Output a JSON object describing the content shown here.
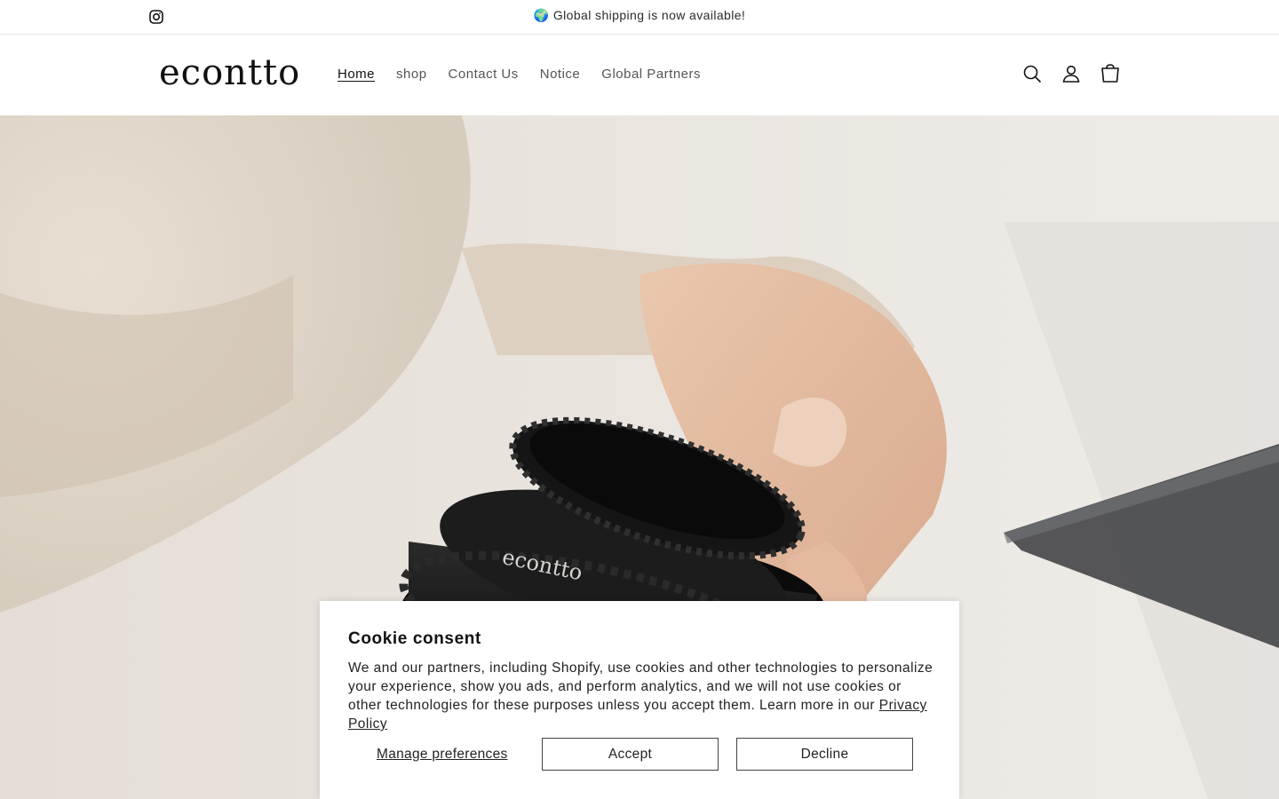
{
  "announcement": {
    "social_icon": "instagram-icon",
    "message": "🌍 Global shipping is now available!"
  },
  "header": {
    "logo": "econtto",
    "nav": [
      {
        "label": "Home",
        "active": true
      },
      {
        "label": "shop"
      },
      {
        "label": "Contact Us"
      },
      {
        "label": "Notice"
      },
      {
        "label": "Global Partners"
      }
    ],
    "icons": [
      "search-icon",
      "account-icon",
      "cart-icon"
    ]
  },
  "hero": {
    "product_brand": "econtto"
  },
  "cookie": {
    "title": "Cookie consent",
    "body": "We and our partners, including Shopify, use cookies and other technologies to personalize your experience, show you ads, and perform analytics, and we will not use cookies or other technologies for these purposes unless you accept them. Learn more in our",
    "privacy_link": "Privacy Policy",
    "manage": "Manage preferences",
    "accept": "Accept",
    "decline": "Decline"
  },
  "colors": {
    "text": "#121212",
    "border": "#e6e6e6"
  }
}
